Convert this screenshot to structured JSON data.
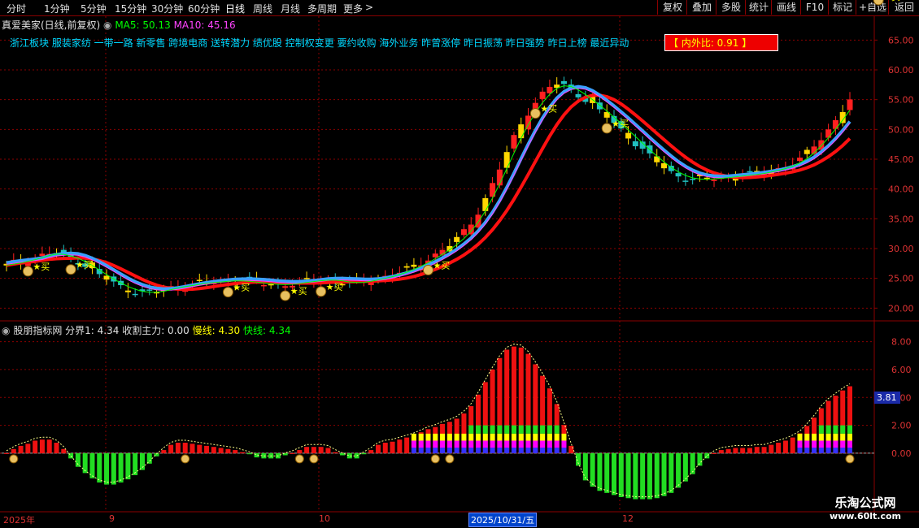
{
  "toolbar": {
    "periods": [
      "分时",
      "1分钟",
      "5分钟",
      "15分钟",
      "30分钟",
      "60分钟",
      "日线",
      "周线",
      "月线",
      "多周期",
      "更多"
    ],
    "more_arrow": ">",
    "active_period": "日线",
    "right_buttons": [
      "复权",
      "叠加",
      "多股",
      "统计",
      "画线",
      "F10",
      "标记",
      "+自选",
      "返回"
    ]
  },
  "price_panel": {
    "stock_title": "真爱美家(日线,前复权)",
    "ma5_label": "MA5: 50.13",
    "ma10_label": "MA10: 45.16",
    "concepts": "浙江板块 服装家纺 一带一路 新零售 跨境电商 送转潜力 绩优股 控制权变更 要约收购 海外业务 昨曾涨停 昨日振荡 昨日强势 昨日上榜 最近异动",
    "inner_outer_ratio": "【 内外比: 0.91 】",
    "y_ticks": [
      "65.00",
      "60.00",
      "55.00",
      "50.00",
      "45.00",
      "40.00",
      "35.00",
      "30.00",
      "25.00",
      "20.00"
    ],
    "buy_label": "买",
    "buy_markers": [
      3,
      9,
      31,
      39,
      44,
      59,
      74,
      84,
      122
    ]
  },
  "indicator_panel": {
    "name": "股朋指标网",
    "boundary_label": "分界1: 4.34",
    "main_force_label": "收割主力: 0.00",
    "slow_label": "慢线: 4.30",
    "fast_label": "快线: 4.34",
    "y_ticks": [
      "8.00",
      "6.00",
      "4.00",
      "2.00",
      "0.00"
    ],
    "current_value": "3.81"
  },
  "date_axis": {
    "labels": [
      "2025年",
      "9",
      "10",
      "12"
    ],
    "selected_date": "2025/10/31/五"
  },
  "watermark": {
    "site_name": "乐淘公式网",
    "url": "www.60lt.com"
  },
  "colors": {
    "up": "#ff2020",
    "down": "#20c0c0",
    "yellow_bar": "#ffd700",
    "ma5": "#ffffff",
    "ma10": "#ff00ff",
    "concept_text": "#00d8ff",
    "grid": "#8b0000",
    "green_bar": "#22dd22",
    "red_bar": "#ee1111"
  },
  "chart_data": {
    "type": "candlestick",
    "price_axis_range": [
      18,
      69
    ],
    "indicator_axis_range": [
      -4.2,
      9.2
    ],
    "closes": [
      27.2,
      27.6,
      27.9,
      28.1,
      28.4,
      28.9,
      29.2,
      29.1,
      28.8,
      28.4,
      27.9,
      27.2,
      26.4,
      25.6,
      24.9,
      24.2,
      23.6,
      23.1,
      22.8,
      22.6,
      22.6,
      22.8,
      23.1,
      23.4,
      23.6,
      23.8,
      24.0,
      24.2,
      24.3,
      24.4,
      24.5,
      24.6,
      24.6,
      24.5,
      24.4,
      24.2,
      24.1,
      24.0,
      23.9,
      24.0,
      24.1,
      24.3,
      24.5,
      24.6,
      24.7,
      24.8,
      24.6,
      24.4,
      24.2,
      24.3,
      24.5,
      24.7,
      25.0,
      25.3,
      25.6,
      26.0,
      26.5,
      27.0,
      27.6,
      28.3,
      29.0,
      29.8,
      30.6,
      31.6,
      32.8,
      34.3,
      36.2,
      38.4,
      40.8,
      43.4,
      46.1,
      48.6,
      50.9,
      52.9,
      54.6,
      56.0,
      57.1,
      57.6,
      57.3,
      56.7,
      55.9,
      55.0,
      54.1,
      53.1,
      52.1,
      51.0,
      49.9,
      48.8,
      47.7,
      46.6,
      45.5,
      44.5,
      43.6,
      42.8,
      42.2,
      41.8,
      41.6,
      41.6,
      41.7,
      41.8,
      41.9,
      42.0,
      42.2,
      42.3,
      42.4,
      42.6,
      42.8,
      43.1,
      43.4,
      43.8,
      44.3,
      45.0,
      46.0,
      47.2,
      48.6,
      50.0,
      51.5,
      53.2,
      55.0
    ]
  }
}
